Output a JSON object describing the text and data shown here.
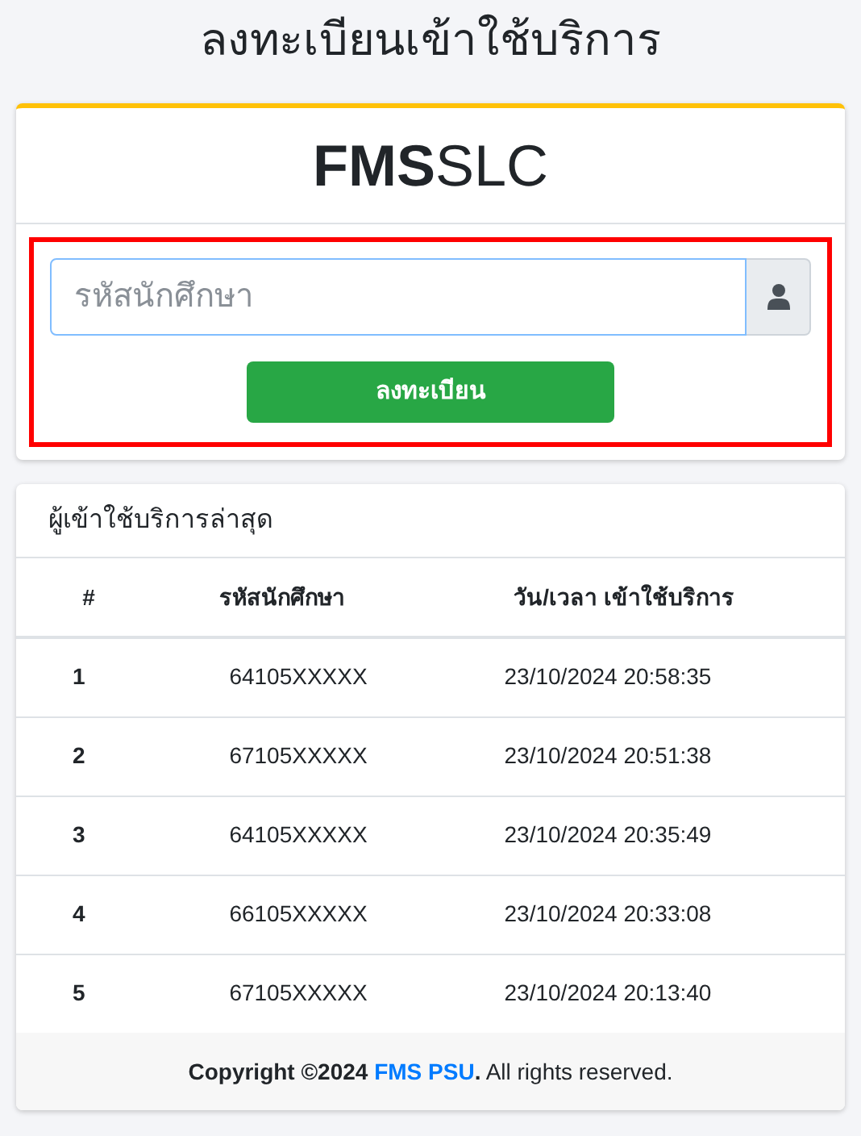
{
  "page_title": "ลงทะเบียนเข้าใช้บริการ",
  "logo": {
    "bold": "FMS",
    "light": "SLC"
  },
  "register_form": {
    "placeholder": "รหัสนักศึกษา",
    "focused": true,
    "submit": "ลงทะเบียน"
  },
  "recent": {
    "title": "ผู้เข้าใช้บริการล่าสุด",
    "columns": [
      "#",
      "รหัสนักศึกษา",
      "วัน/เวลา เข้าใช้บริการ"
    ],
    "rows": [
      {
        "index": "1",
        "student_id": "64105XXXXX",
        "datetime": "23/10/2024 20:58:35"
      },
      {
        "index": "2",
        "student_id": "67105XXXXX",
        "datetime": "23/10/2024 20:51:38"
      },
      {
        "index": "3",
        "student_id": "64105XXXXX",
        "datetime": "23/10/2024 20:35:49"
      },
      {
        "index": "4",
        "student_id": "66105XXXXX",
        "datetime": "23/10/2024 20:33:08"
      },
      {
        "index": "5",
        "student_id": "67105XXXXX",
        "datetime": "23/10/2024 20:13:40"
      }
    ]
  },
  "footer": {
    "prefix": "Copyright ©2024 ",
    "link": "FMS PSU",
    "suffix": "**.** All rights reserved."
  }
}
